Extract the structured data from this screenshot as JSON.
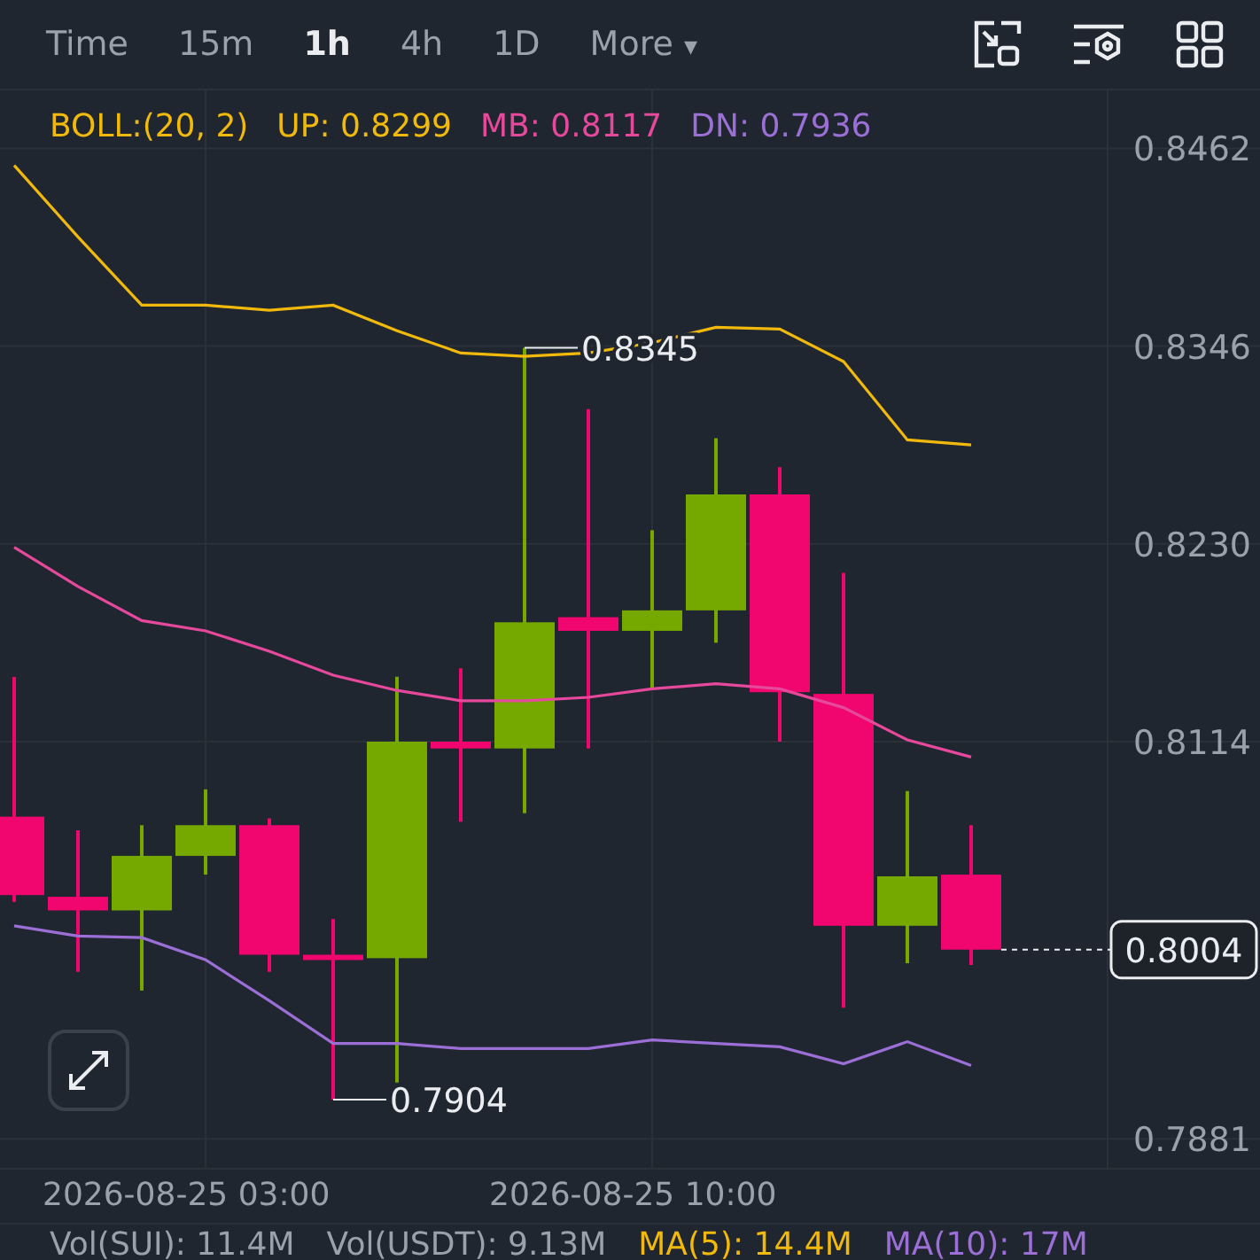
{
  "toolbar": {
    "intervals": [
      {
        "label": "Time",
        "selected": false
      },
      {
        "label": "15m",
        "selected": false
      },
      {
        "label": "1h",
        "selected": true
      },
      {
        "label": "4h",
        "selected": false
      },
      {
        "label": "1D",
        "selected": false
      }
    ],
    "more": {
      "label": "More",
      "caret": "▾"
    }
  },
  "legend": [
    {
      "text": "BOLL:(20, 2)",
      "color": "#f0b90b"
    },
    {
      "text": "UP: 0.8299",
      "color": "#f0b90b"
    },
    {
      "text": "MB: 0.8117",
      "color": "#e6489c"
    },
    {
      "text": "DN: 0.7936",
      "color": "#9c6fd6"
    }
  ],
  "chart_data": {
    "type": "line",
    "grid": true,
    "ylim": [
      0.7864,
      0.8496
    ],
    "categories": [
      null,
      null,
      null,
      "2026-08-25 03:00",
      null,
      null,
      null,
      null,
      null,
      null,
      "2026-08-25 10:00",
      null,
      null,
      null,
      null,
      null
    ],
    "yticks": [
      {
        "value": 0.8462,
        "label": "0.8462"
      },
      {
        "value": 0.8346,
        "label": "0.8346"
      },
      {
        "value": 0.823,
        "label": "0.8230"
      },
      {
        "value": 0.8114,
        "label": "0.8114"
      },
      {
        "value": 0.7881,
        "label": "0.7881"
      }
    ],
    "series": [
      {
        "color": "#f0b90b",
        "values": [
          0.8452,
          0.841,
          0.837,
          0.837,
          0.8367,
          0.837,
          0.8355,
          0.8342,
          0.834,
          0.8342,
          0.8348,
          0.8357,
          0.8356,
          0.8337,
          0.8291,
          0.8288
        ]
      },
      {
        "color": "#e6489c",
        "values": [
          0.8228,
          0.8205,
          0.8185,
          0.8179,
          0.8167,
          0.8153,
          0.8144,
          0.8138,
          0.8138,
          0.814,
          0.8145,
          0.8148,
          0.8145,
          0.8134,
          0.8115,
          0.8105
        ]
      },
      {
        "color": "#9c6fd6",
        "values": [
          0.8006,
          0.8,
          0.7999,
          0.7986,
          0.7962,
          0.7937,
          0.7937,
          0.7934,
          0.7934,
          0.7934,
          0.7939,
          0.7937,
          0.7935,
          0.7925,
          0.7938,
          0.7924
        ]
      }
    ],
    "annotations": [
      "0.8345",
      "0.7904",
      "0.8004"
    ]
  },
  "volume_legend": [
    {
      "text": "Vol(SUI): 11.4M",
      "color": "#9aa1ab"
    },
    {
      "text": "Vol(USDT): 9.13M",
      "color": "#9aa1ab"
    },
    {
      "text": "MA(5): 14.4M",
      "color": "#f0b90b"
    },
    {
      "text": "MA(10): 17M",
      "color": "#9c6fd6"
    }
  ]
}
